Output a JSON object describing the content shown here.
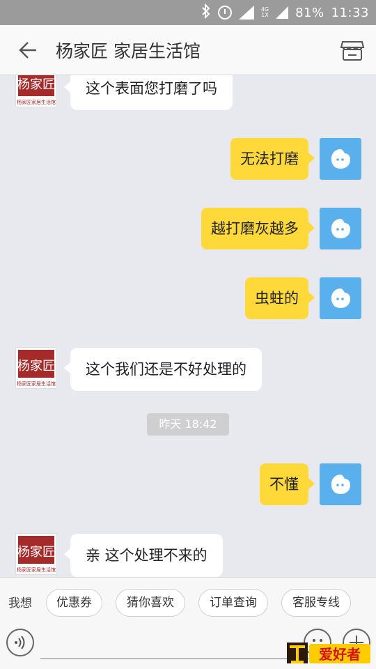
{
  "status_bar": {
    "net_label_top": "4G",
    "net_label_bottom": "1X",
    "battery": "81%",
    "time": "11:33"
  },
  "header": {
    "title": "杨家匠 家居生活馆"
  },
  "seller_avatar": {
    "logo_text": "杨家匠",
    "caption": "杨家匠家居生活馆"
  },
  "messages": {
    "m1": "这个表面您打磨了吗",
    "m2": "无法打磨",
    "m3": "越打磨灰越多",
    "m4": "虫蛀的",
    "m5": "这个我们还是不好处理的",
    "time_separator": "昨天 18:42",
    "m6": "不懂",
    "m7": "亲  这个处理不来的"
  },
  "quick_bar": {
    "label": "我想",
    "chips": [
      "优惠券",
      "猜你喜欢",
      "订单查询",
      "客服专线"
    ]
  },
  "watermark": {
    "text": "爱好者"
  },
  "colors": {
    "accent_blue": "#5ab0ec",
    "bubble_yellow": "#ffd83a",
    "logo_red": "#a52a2a"
  }
}
